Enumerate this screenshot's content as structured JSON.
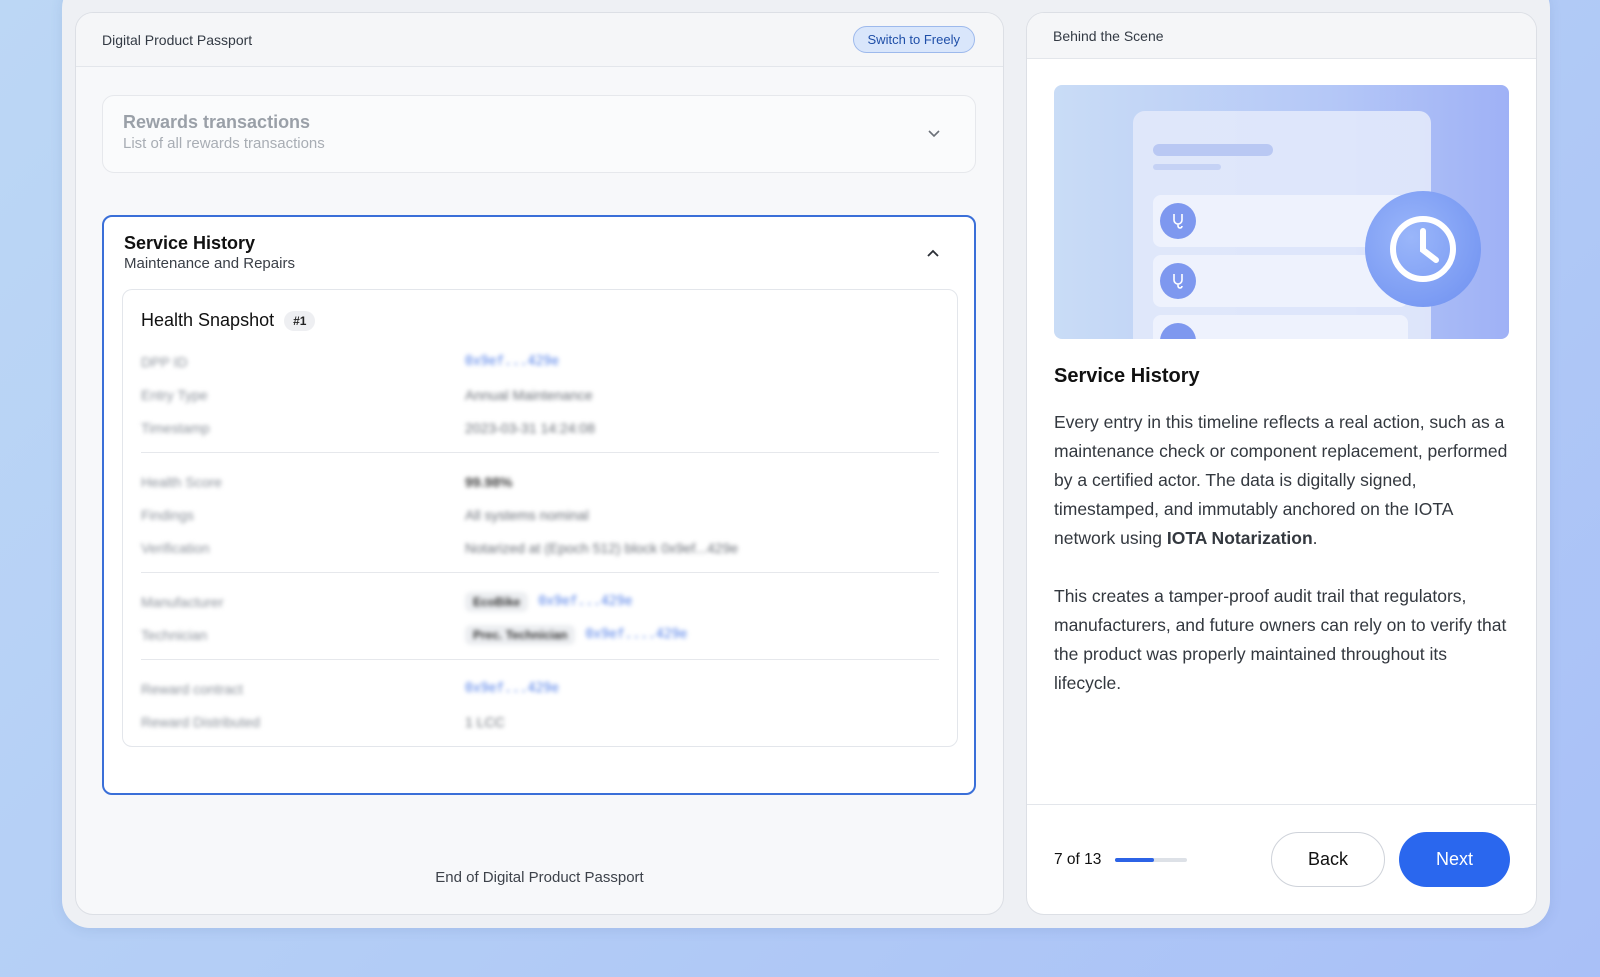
{
  "left_panel": {
    "title": "Digital Product Passport",
    "switch_label": "Switch to Freely",
    "rewards": {
      "title": "Rewards transactions",
      "subtitle": "List of all rewards transactions"
    },
    "service": {
      "title": "Service History",
      "subtitle": "Maintenance and Repairs",
      "snapshot_title": "Health Snapshot",
      "snapshot_badge": "#1",
      "groups": [
        [
          {
            "key": "DPP ID",
            "value": "0x9ef...429e",
            "style": "link"
          },
          {
            "key": "Entry Type",
            "value": "Annual Maintenance",
            "style": "plain"
          },
          {
            "key": "Timestamp",
            "value": "2023-03-31 14:24:08",
            "style": "plain"
          }
        ],
        [
          {
            "key": "Health Score",
            "value": "99.98%",
            "style": "bold"
          },
          {
            "key": "Findings",
            "value": "All systems nominal",
            "style": "plain"
          },
          {
            "key": "Verification",
            "value": "Notarized at (Epoch 512) block 0x9ef...429e",
            "style": "plain"
          }
        ],
        [
          {
            "key": "Manufacturer",
            "chip": "EcoBike",
            "value": "0x9ef...429e",
            "style": "link"
          },
          {
            "key": "Technician",
            "chip": "Prec. Technician",
            "value": "0x9ef....429e",
            "style": "link"
          }
        ],
        [
          {
            "key": "Reward contract",
            "value": "0x9ef...429e",
            "style": "link"
          },
          {
            "key": "Reward Distributed",
            "value": "1 LCC",
            "style": "plain"
          }
        ]
      ]
    },
    "end_text": "End of Digital Product Passport"
  },
  "right_panel": {
    "title": "Behind the Scene",
    "heading": "Service History",
    "para1_a": "Every entry in this timeline reflects a real action, such as a maintenance check or component replacement, performed by a certified actor. The data is digitally signed, timestamped, and immutably anchored on the IOTA network using ",
    "para1_bold": "IOTA Notarization",
    "para1_end": ".",
    "para2": "This creates a tamper-proof audit trail that regulators, manufacturers, and future owners can rely on to verify that the product was properly maintained throughout its lifecycle.",
    "progress_label": "7 of 13",
    "progress_fraction": 0.538,
    "back_label": "Back",
    "next_label": "Next"
  },
  "icons": {
    "chevron_down": "chevron-down-icon",
    "chevron_up": "chevron-up-icon",
    "stethoscope": "stethoscope-icon",
    "clock": "clock-icon"
  },
  "colors": {
    "accent": "#2a67ee",
    "active_border": "#3a6fd8"
  }
}
